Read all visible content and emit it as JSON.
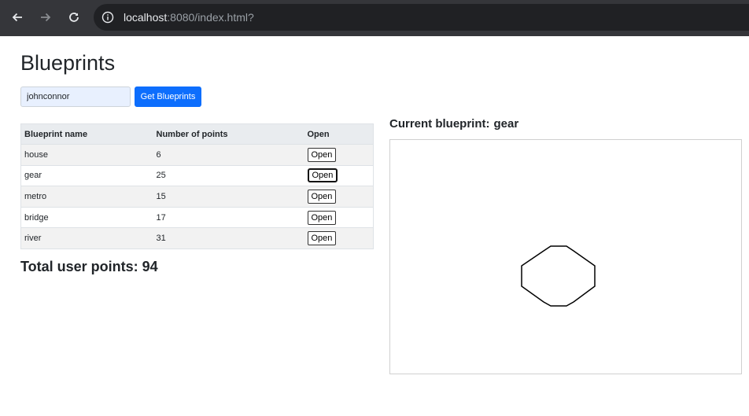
{
  "browser": {
    "url_host": "localhost",
    "url_rest": ":8080/index.html?"
  },
  "page": {
    "title": "Blueprints",
    "author_input_value": "johnconnor",
    "get_button_label": "Get Blueprints"
  },
  "table": {
    "headers": [
      "Blueprint name",
      "Number of points",
      "Open"
    ],
    "rows": [
      {
        "name": "house",
        "points": "6",
        "open_label": "Open"
      },
      {
        "name": "gear",
        "points": "25",
        "open_label": "Open"
      },
      {
        "name": "metro",
        "points": "15",
        "open_label": "Open"
      },
      {
        "name": "bridge",
        "points": "17",
        "open_label": "Open"
      },
      {
        "name": "river",
        "points": "31",
        "open_label": "Open"
      }
    ]
  },
  "total": {
    "label": "Total user points:",
    "value": "94"
  },
  "current": {
    "label": "Current blueprint:",
    "name": "gear"
  }
}
